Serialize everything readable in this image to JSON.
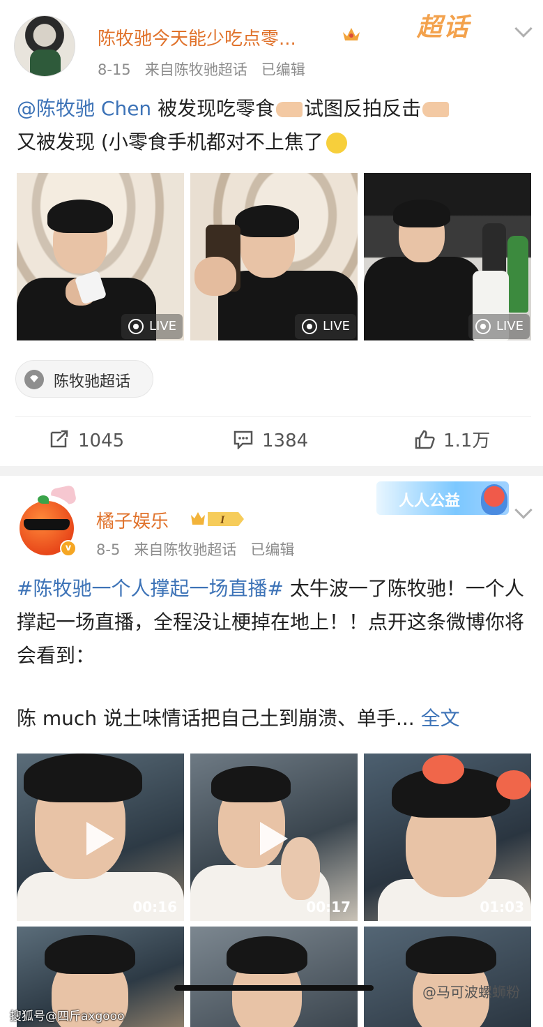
{
  "post1": {
    "username": "陈牧驰今天能少吃点零...",
    "date": "8-15",
    "source": "来自陈牧驰超话",
    "edited": "已编辑",
    "badge_text": "超话",
    "mention": "@陈牧驰 Chen",
    "text_a": " 被发现吃零食",
    "text_b": "试图反拍反击",
    "text_c": "又被发现 (小零食手机都对不上焦了",
    "live_label": "LIVE",
    "tag_label": "陈牧驰超话",
    "repost_count": "1045",
    "comment_count": "1384",
    "like_count": "1.1万"
  },
  "post2": {
    "username": "橘子娱乐",
    "rank_badge": "I",
    "date": "8-5",
    "source": "来自陈牧驰超话",
    "edited": "已编辑",
    "banner_text": "人人公益",
    "hashtag": "#陈牧驰一个人撑起一场直播#",
    "body": " 太牛波一了陈牧驰！一个人撑起一场直播，全程没让梗掉在地上！！点开这条微博你将会看到：",
    "second_line": "陈 much 说土味情话把自己土到崩溃、单手...",
    "full_text_link": "全文",
    "videos": [
      {
        "duration": "00:16"
      },
      {
        "duration": "00:17"
      },
      {
        "duration": "01:03"
      }
    ]
  },
  "watermarks": {
    "weibo": "@马可波螺蛳粉",
    "sohu": "搜狐号@四斤axgooo"
  },
  "colors": {
    "username": "#e0722b",
    "link": "#3d73b7",
    "meta": "#8c8c8c"
  }
}
